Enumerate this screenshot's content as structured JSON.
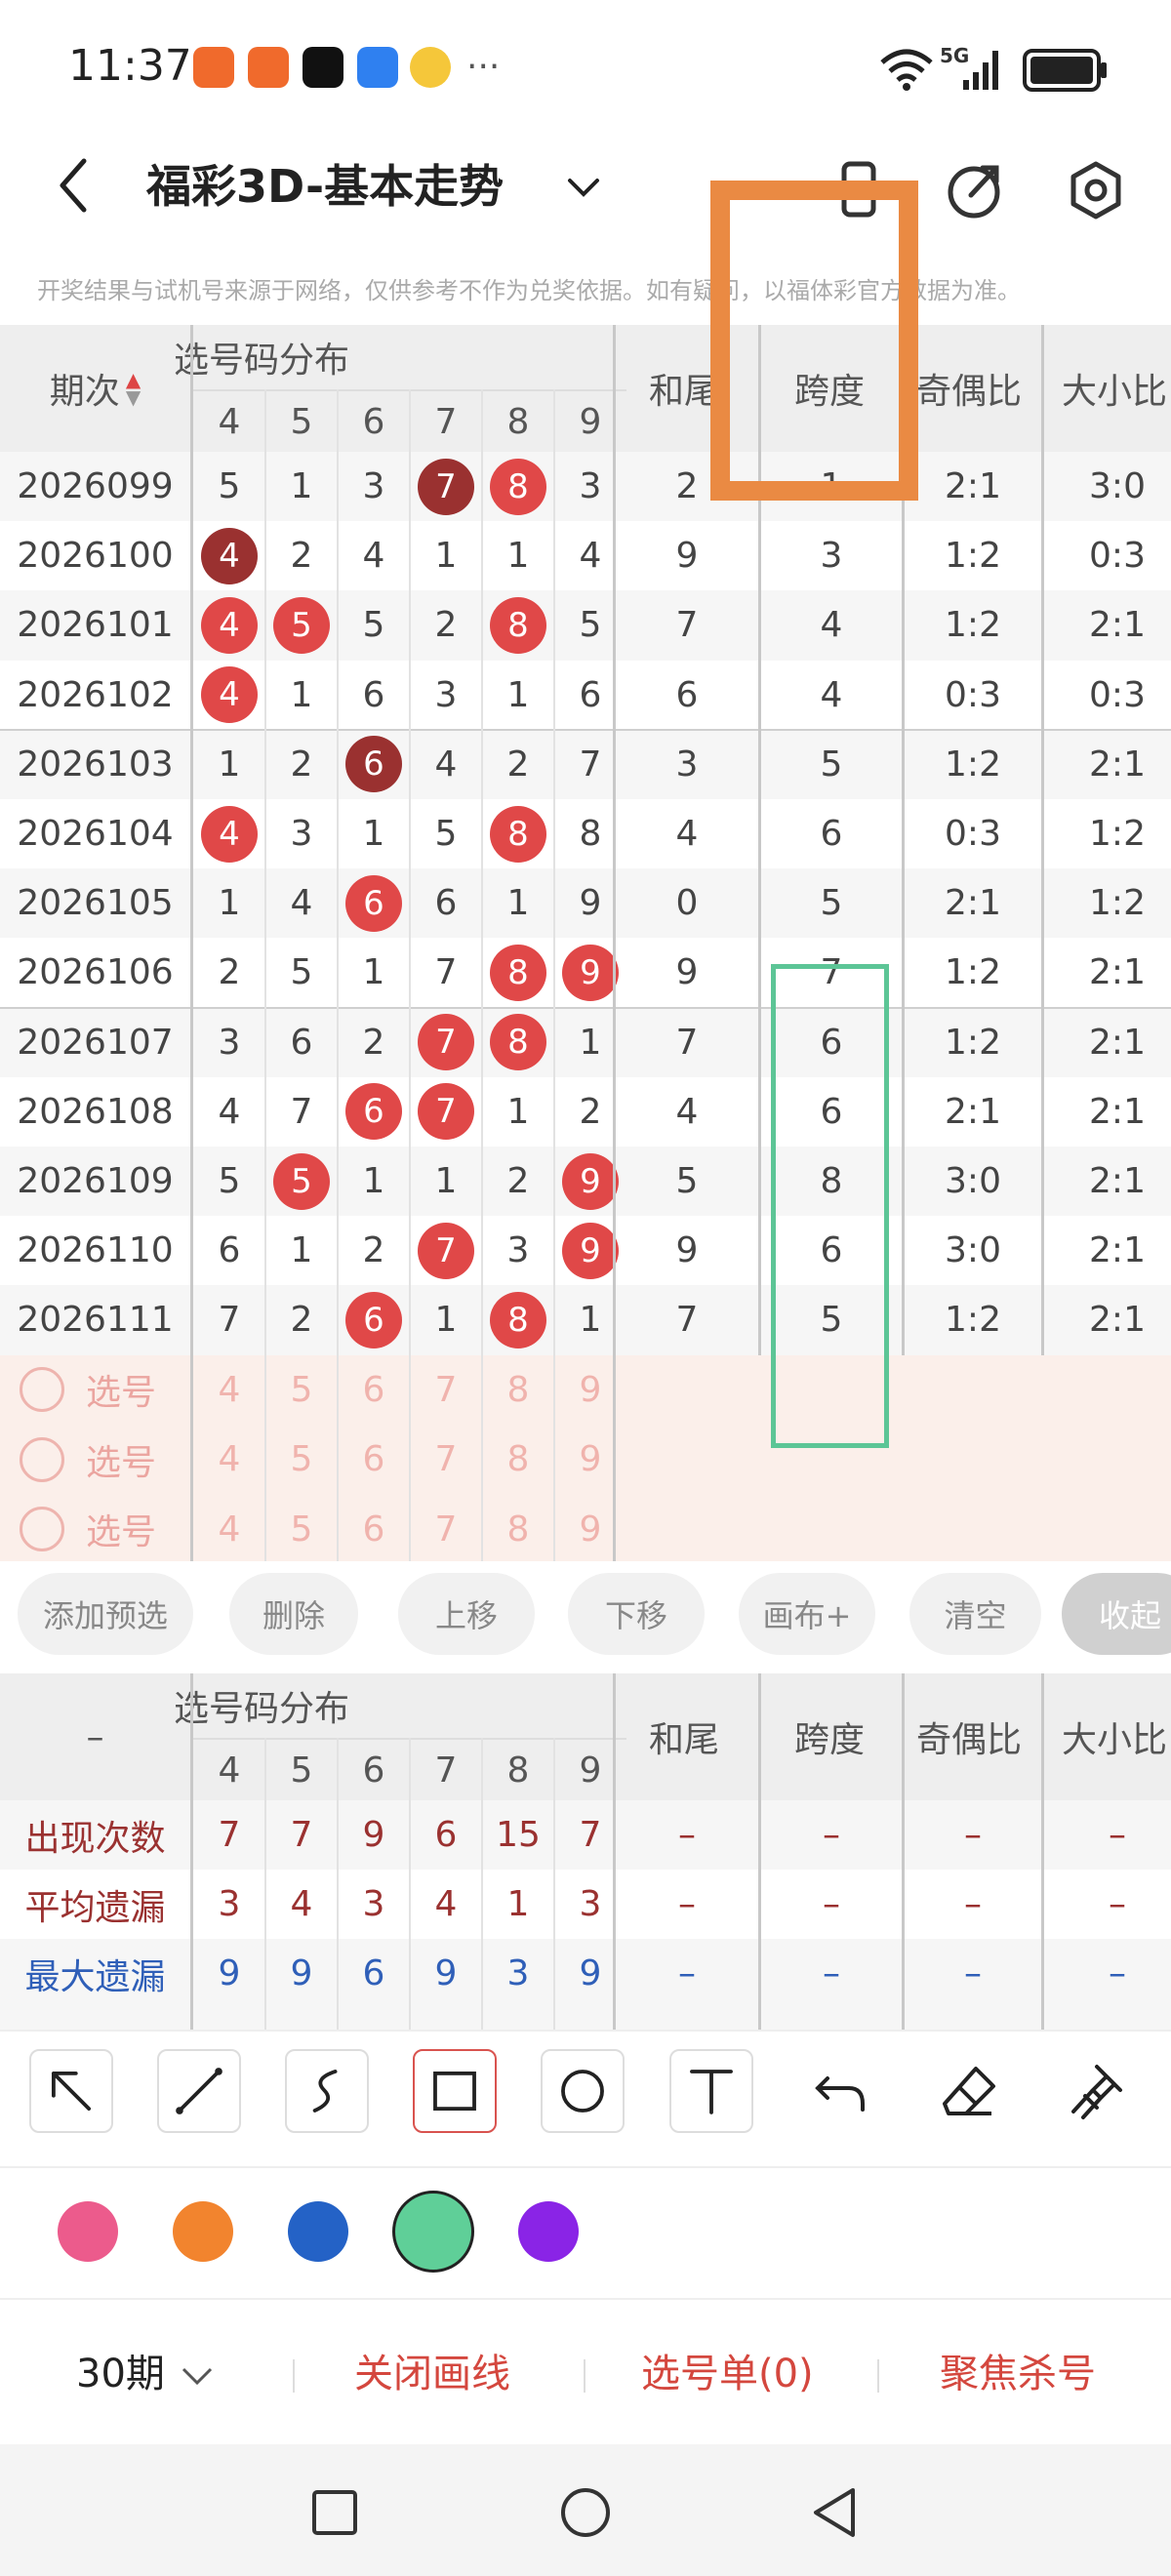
{
  "status": {
    "time": "11:37",
    "dots": "···",
    "network": "5G"
  },
  "header": {
    "title": "福彩3D-基本走势",
    "disclaimer": "开奖结果与试机号来源于网络，仅供参考不作为兑奖依据。如有疑问，以福体彩官方数据为准。"
  },
  "table": {
    "col_period": "期次",
    "dist_title": "选号码分布",
    "digits": [
      "4",
      "5",
      "6",
      "7",
      "8",
      "9"
    ],
    "col_hewei": "和尾",
    "col_kuadu": "跨度",
    "col_qiou": "奇偶比",
    "col_daxiao": "大小比",
    "rows": [
      {
        "period": "2026099",
        "d": [
          "5",
          "1",
          "3",
          "7",
          "8",
          "3"
        ],
        "hits": [
          0,
          0,
          0,
          2,
          1,
          0
        ],
        "hewei": "2",
        "kuadu": "1",
        "qiou": "2:1",
        "daxiao": "3:0"
      },
      {
        "period": "2026100",
        "d": [
          "4",
          "2",
          "4",
          "1",
          "1",
          "4"
        ],
        "hits": [
          2,
          0,
          0,
          0,
          0,
          0
        ],
        "hewei": "9",
        "kuadu": "3",
        "qiou": "1:2",
        "daxiao": "0:3"
      },
      {
        "period": "2026101",
        "d": [
          "4",
          "5",
          "5",
          "2",
          "8",
          "5"
        ],
        "hits": [
          1,
          1,
          0,
          0,
          1,
          0
        ],
        "hewei": "7",
        "kuadu": "4",
        "qiou": "1:2",
        "daxiao": "2:1"
      },
      {
        "period": "2026102",
        "d": [
          "4",
          "1",
          "6",
          "3",
          "1",
          "6"
        ],
        "hits": [
          1,
          0,
          0,
          0,
          0,
          0
        ],
        "hewei": "6",
        "kuadu": "4",
        "qiou": "0:3",
        "daxiao": "0:3"
      },
      {
        "period": "2026103",
        "d": [
          "1",
          "2",
          "6",
          "4",
          "2",
          "7"
        ],
        "hits": [
          0,
          0,
          2,
          0,
          0,
          0
        ],
        "hewei": "3",
        "kuadu": "5",
        "qiou": "1:2",
        "daxiao": "2:1"
      },
      {
        "period": "2026104",
        "d": [
          "4",
          "3",
          "1",
          "5",
          "8",
          "8"
        ],
        "hits": [
          1,
          0,
          0,
          0,
          1,
          0
        ],
        "hewei": "4",
        "kuadu": "6",
        "qiou": "0:3",
        "daxiao": "1:2"
      },
      {
        "period": "2026105",
        "d": [
          "1",
          "4",
          "6",
          "6",
          "1",
          "9"
        ],
        "hits": [
          0,
          0,
          1,
          0,
          0,
          0
        ],
        "hewei": "0",
        "kuadu": "5",
        "qiou": "2:1",
        "daxiao": "1:2"
      },
      {
        "period": "2026106",
        "d": [
          "2",
          "5",
          "1",
          "7",
          "8",
          "9"
        ],
        "hits": [
          0,
          0,
          0,
          0,
          1,
          1
        ],
        "hewei": "9",
        "kuadu": "7",
        "qiou": "1:2",
        "daxiao": "2:1"
      },
      {
        "period": "2026107",
        "d": [
          "3",
          "6",
          "2",
          "7",
          "8",
          "1"
        ],
        "hits": [
          0,
          0,
          0,
          1,
          1,
          0
        ],
        "hewei": "7",
        "kuadu": "6",
        "qiou": "1:2",
        "daxiao": "2:1"
      },
      {
        "period": "2026108",
        "d": [
          "4",
          "7",
          "6",
          "7",
          "1",
          "2"
        ],
        "hits": [
          0,
          0,
          1,
          1,
          0,
          0
        ],
        "hewei": "4",
        "kuadu": "6",
        "qiou": "2:1",
        "daxiao": "2:1"
      },
      {
        "period": "2026109",
        "d": [
          "5",
          "5",
          "1",
          "1",
          "2",
          "9"
        ],
        "hits": [
          0,
          1,
          0,
          0,
          0,
          1
        ],
        "hewei": "5",
        "kuadu": "8",
        "qiou": "3:0",
        "daxiao": "2:1"
      },
      {
        "period": "2026110",
        "d": [
          "6",
          "1",
          "2",
          "7",
          "3",
          "9"
        ],
        "hits": [
          0,
          0,
          0,
          1,
          0,
          1
        ],
        "hewei": "9",
        "kuadu": "6",
        "qiou": "3:0",
        "daxiao": "2:1"
      },
      {
        "period": "2026111",
        "d": [
          "7",
          "2",
          "6",
          "1",
          "8",
          "1"
        ],
        "hits": [
          0,
          0,
          1,
          0,
          1,
          0
        ],
        "hewei": "7",
        "kuadu": "5",
        "qiou": "1:2",
        "daxiao": "2:1"
      }
    ],
    "select_rows": [
      {
        "label": "选号",
        "digits": [
          "4",
          "5",
          "6",
          "7",
          "8",
          "9"
        ]
      },
      {
        "label": "选号",
        "digits": [
          "4",
          "5",
          "6",
          "7",
          "8",
          "9"
        ]
      },
      {
        "label": "选号",
        "digits": [
          "4",
          "5",
          "6",
          "7",
          "8",
          "9"
        ]
      }
    ]
  },
  "actions": [
    "添加预选",
    "删除",
    "上移",
    "下移",
    "画布+",
    "清空",
    "收起"
  ],
  "stats": {
    "col_first": "–",
    "dist_title": "选号码分布",
    "digits": [
      "4",
      "5",
      "6",
      "7",
      "8",
      "9"
    ],
    "col_hewei": "和尾",
    "col_kuadu": "跨度",
    "col_qiou": "奇偶比",
    "col_daxiao": "大小比",
    "rows": [
      {
        "label": "出现次数",
        "values": [
          "7",
          "7",
          "9",
          "6",
          "15",
          "7"
        ],
        "rest": [
          "–",
          "–",
          "–",
          "–"
        ],
        "color": "#9a3130"
      },
      {
        "label": "平均遗漏",
        "values": [
          "3",
          "4",
          "3",
          "4",
          "1",
          "3"
        ],
        "rest": [
          "–",
          "–",
          "–",
          "–"
        ],
        "color": "#9a3130"
      },
      {
        "label": "最大遗漏",
        "values": [
          "9",
          "9",
          "6",
          "9",
          "3",
          "9"
        ],
        "rest": [
          "–",
          "–",
          "–",
          "–"
        ],
        "color": "#2f5fb8"
      }
    ]
  },
  "tools": [
    "arrow-tool",
    "line-tool",
    "curve-tool",
    "rectangle-tool",
    "circle-tool",
    "text-tool",
    "undo-tool",
    "eraser-tool",
    "clear-brush-tool"
  ],
  "colors": [
    "#ec5b8c",
    "#f2842e",
    "#2462c6",
    "#5fcf98",
    "#8a24e6"
  ],
  "bottom": {
    "period_select": "30期",
    "close_lines": "关闭画线",
    "pick_list": "选号单(0)",
    "focus_kill": "聚焦杀号"
  },
  "overlay_colors": {
    "orange": "#ea8a43",
    "green": "#5cc596"
  }
}
